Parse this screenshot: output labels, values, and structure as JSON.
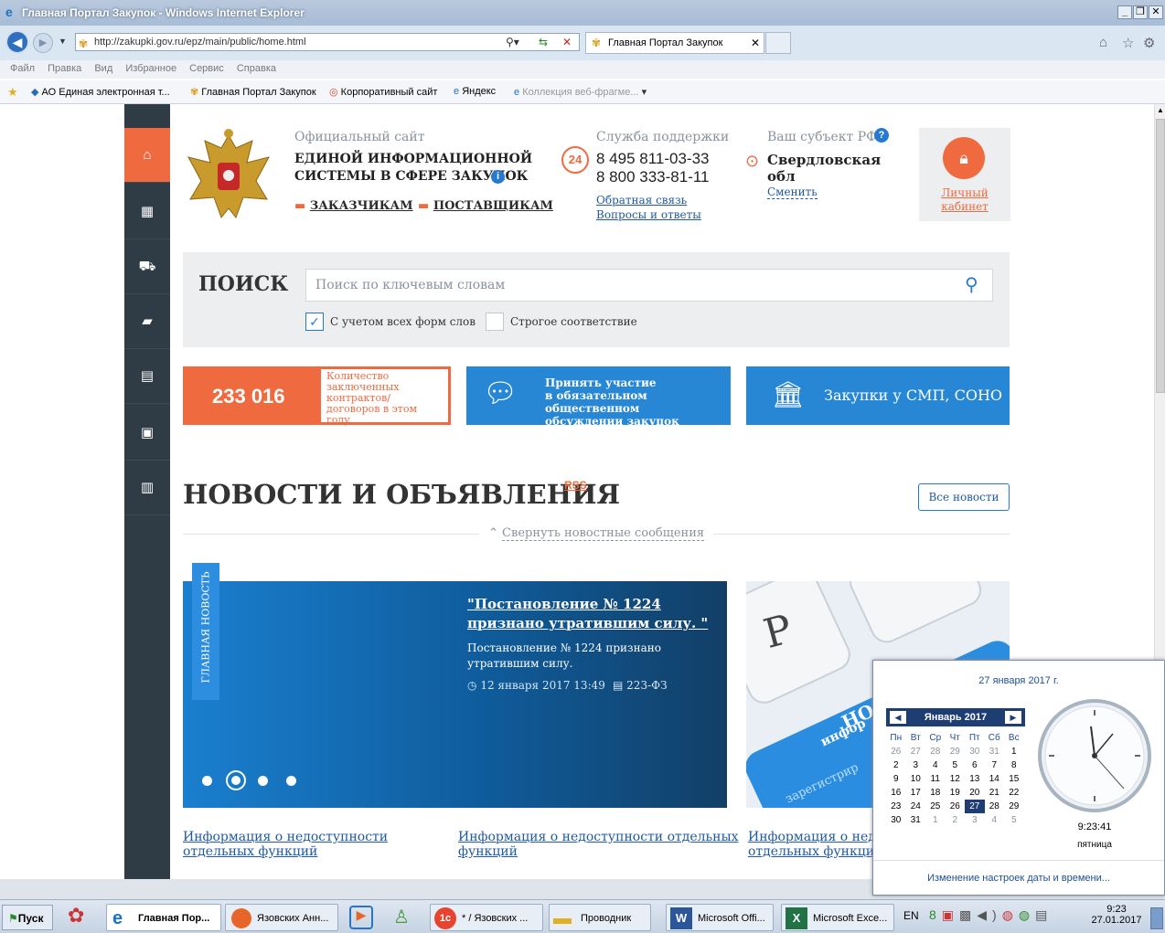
{
  "window": {
    "title": "Главная Портал Закупок - Windows Internet Explorer",
    "controls": [
      "_",
      "❐",
      "✕"
    ]
  },
  "browser": {
    "url": "http://zakupki.gov.ru/epz/main/public/home.html",
    "tab_label": "Главная Портал Закупок",
    "menu": [
      "Файл",
      "Правка",
      "Вид",
      "Избранное",
      "Сервис",
      "Справка"
    ],
    "favorites": [
      "АО Единая электронная т...",
      "Главная Портал Закупок",
      "Корпоративный сайт",
      "Яндекс",
      "Коллекция веб-фрагме..."
    ]
  },
  "header": {
    "official_site": "Официальный сайт",
    "system_name_1": "ЕДИНОЙ ИНФОРМАЦИОННОЙ",
    "system_name_2": "СИСТЕМЫ В СФЕРЕ ЗАКУПОК",
    "customers_link": "ЗАКАЗЧИКАМ",
    "suppliers_link": "ПОСТАВЩИКАМ",
    "support_title": "Служба поддержки",
    "support_badge": "24",
    "phone_1": "8 495 811-03-33",
    "phone_2": "8 800 333-81-11",
    "feedback_link": "Обратная связь",
    "faq_link": "Вопросы и ответы",
    "region_title": "Ваш субъект РФ",
    "region_name_1": "Свердловская",
    "region_name_2": "обл",
    "region_change": "Сменить",
    "cabinet_1": "Личный",
    "cabinet_2": "кабинет"
  },
  "search": {
    "title": "ПОИСК",
    "placeholder": "Поиск по ключевым словам",
    "option_all_forms": "С учетом всех форм слов",
    "option_all_forms_checked": true,
    "option_strict": "Строгое соответствие",
    "option_strict_checked": false
  },
  "stats": {
    "count": "233 016",
    "count_label_1": "Количество",
    "count_label_2": "заключенных",
    "count_label_3": "контрактов/",
    "count_label_4": "договоров в этом",
    "count_label_5": "году",
    "discussion_1": "Принять участие",
    "discussion_2": "в обязательном общественном",
    "discussion_3": "обсуждении закупок",
    "smp_label": "Закупки у СМП, СОНО"
  },
  "news": {
    "title": "НОВОСТИ И ОБЪЯВЛЕНИЯ",
    "rss": "RSS",
    "all_news": "Все новости",
    "collapse": "Свернуть новостные сообщения",
    "main_badge": "ГЛАВНАЯ НОВОСТЬ",
    "headline_1": "\"Постановление № 1224",
    "headline_2": "признано утратившим силу. \"",
    "summary_1": "Постановление № 1224 признано",
    "summary_2": "утратившим силу.",
    "date": "12 января 2017 13:49",
    "law": "223-ФЗ",
    "slide_active": 2,
    "slide_count": 4,
    "image_text_1": "НО",
    "image_text_2": "инфор",
    "image_text_3": "зарегистрир",
    "links": [
      {
        "l1": "Информация о недоступности",
        "l2": "отдельных функций"
      },
      {
        "l1": "Информация о недоступности отдельных",
        "l2": "функций"
      },
      {
        "l1": "Информация о недо",
        "l2": "отдельных функци"
      }
    ]
  },
  "calendar": {
    "full_date": "27 января 2017 г.",
    "month": "Январь 2017",
    "weekdays": [
      "Пн",
      "Вт",
      "Ср",
      "Чт",
      "Пт",
      "Сб",
      "Вс"
    ],
    "weeks": [
      [
        "26",
        "27",
        "28",
        "29",
        "30",
        "31",
        "1"
      ],
      [
        "2",
        "3",
        "4",
        "5",
        "6",
        "7",
        "8"
      ],
      [
        "9",
        "10",
        "11",
        "12",
        "13",
        "14",
        "15"
      ],
      [
        "16",
        "17",
        "18",
        "19",
        "20",
        "21",
        "22"
      ],
      [
        "23",
        "24",
        "25",
        "26",
        "27",
        "28",
        "29"
      ],
      [
        "30",
        "31",
        "1",
        "2",
        "3",
        "4",
        "5"
      ]
    ],
    "selected_day": "27",
    "time": "9:23:41",
    "weekday_name": "пятница",
    "settings_link": "Изменение настроек даты и времени..."
  },
  "taskbar": {
    "start": "Пуск",
    "tasks": [
      "Главная Пор...",
      "Язовских Анн...",
      "* / Язовских ...",
      "Проводник",
      "Microsoft Offi...",
      "Microsoft Exce..."
    ],
    "lang": "EN",
    "clock_time": "9:23",
    "clock_date": "27.01.2017"
  }
}
